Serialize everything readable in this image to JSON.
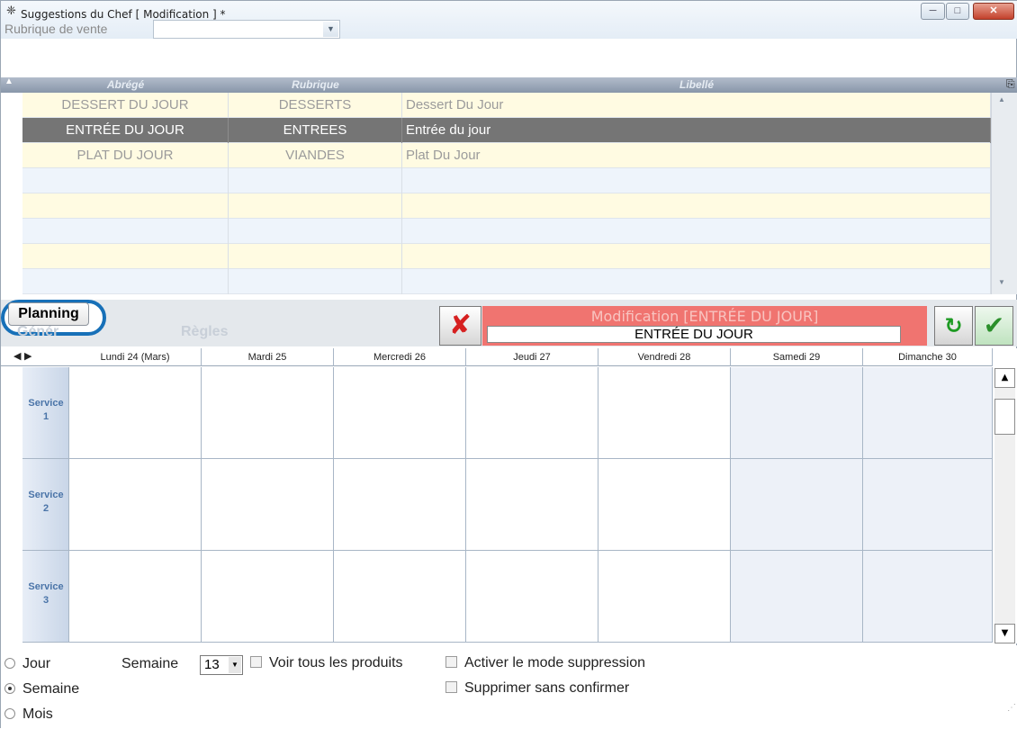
{
  "window": {
    "title": "Suggestions du Chef  [ Modification ] *",
    "minimize_label": "─",
    "maximize_label": "□",
    "close_label": "✕"
  },
  "filter": {
    "label": "Rubrique de vente",
    "value": ""
  },
  "grid": {
    "columns": [
      "Abrégé",
      "Rubrique",
      "Libellé"
    ],
    "rows": [
      {
        "abrege": "DESSERT DU JOUR",
        "rubrique": "DESSERTS",
        "libelle": "Dessert Du Jour"
      },
      {
        "abrege": "ENTRÉE DU JOUR",
        "rubrique": "ENTREES",
        "libelle": "Entrée du jour"
      },
      {
        "abrege": "PLAT DU JOUR",
        "rubrique": "VIANDES",
        "libelle": "Plat Du Jour"
      }
    ],
    "selected_row": 1
  },
  "tabs": {
    "general": "Génér",
    "planning": "Planning",
    "regles": "Règles"
  },
  "edit": {
    "title": "Modification [ENTRÉE DU JOUR]",
    "value": "ENTRÉE DU JOUR"
  },
  "calendar": {
    "nav": "◀ ▶",
    "days": [
      "Lundi 24 (Mars)",
      "Mardi 25",
      "Mercredi 26",
      "Jeudi 27",
      "Vendredi 28",
      "Samedi 29",
      "Dimanche 30"
    ],
    "weekend_days": [
      5,
      6
    ],
    "services": [
      {
        "word": "Service",
        "num": "1"
      },
      {
        "word": "Service",
        "num": "2"
      },
      {
        "word": "Service",
        "num": "3"
      }
    ]
  },
  "options": {
    "view_modes": [
      {
        "label": "Jour",
        "checked": false
      },
      {
        "label": "Semaine",
        "checked": true
      },
      {
        "label": "Mois",
        "checked": false
      }
    ],
    "week_label": "Semaine",
    "week_value": "13",
    "show_all_products": "Voir tous les produits",
    "delete_mode": "Activer le mode suppression",
    "delete_no_confirm": "Supprimer sans confirmer"
  }
}
